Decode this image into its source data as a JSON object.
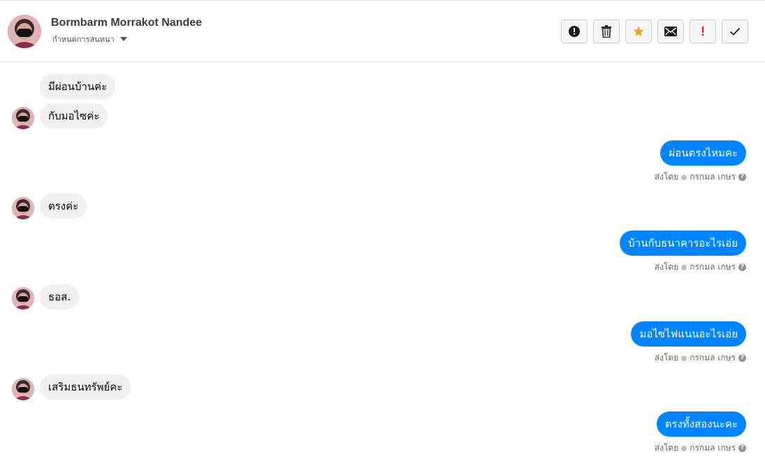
{
  "header": {
    "contact_name": "Bormbarm Morrakot Nandee",
    "subtitle": "กำหนดการสนทนา",
    "toolbar": [
      {
        "icon": "alert-circle-icon",
        "name": "report-button"
      },
      {
        "icon": "trash-icon",
        "name": "delete-button"
      },
      {
        "icon": "star-icon",
        "name": "star-button"
      },
      {
        "icon": "envelope-icon",
        "name": "mark-unread-button"
      },
      {
        "icon": "exclamation-icon",
        "name": "spam-button"
      },
      {
        "icon": "check-icon",
        "name": "done-button"
      }
    ]
  },
  "messages": {
    "in_1": "มีผ่อนบ้านค่ะ",
    "in_2": "กับมอไซค่ะ",
    "out_1": "ผ่อนตรงไหมคะ",
    "in_3": "ตรงค่ะ",
    "out_2": "บ้านกับธนาคารอะไรเอ่ย",
    "in_4": "ธอส.",
    "out_3": "มอไซไฟแนนอะไรเอ่ย",
    "in_5": "เสริมธนทรัพย์คะ",
    "out_4": "ตรงทั้งสองนะคะ"
  },
  "sent_by": {
    "prefix": "ส่งโดย",
    "agent": "กรกมล เกษร",
    "help_glyph": "?"
  },
  "colors": {
    "outgoing_bubble": "#0084ff",
    "incoming_bubble": "#f0f0f0",
    "star": "#f5a623",
    "spam": "#e02a20"
  }
}
